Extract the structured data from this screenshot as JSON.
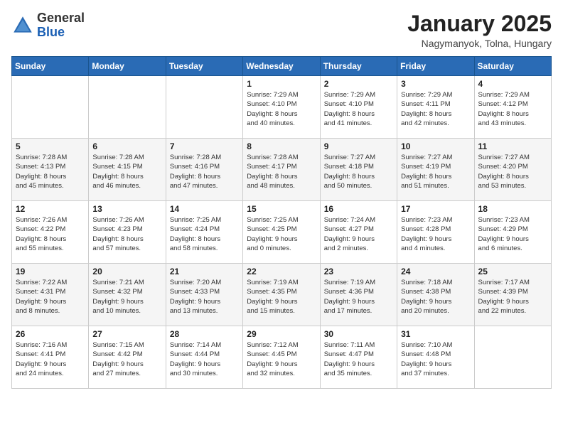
{
  "logo": {
    "general": "General",
    "blue": "Blue"
  },
  "header": {
    "month": "January 2025",
    "location": "Nagymanyok, Tolna, Hungary"
  },
  "weekdays": [
    "Sunday",
    "Monday",
    "Tuesday",
    "Wednesday",
    "Thursday",
    "Friday",
    "Saturday"
  ],
  "weeks": [
    [
      {
        "day": "",
        "info": ""
      },
      {
        "day": "",
        "info": ""
      },
      {
        "day": "",
        "info": ""
      },
      {
        "day": "1",
        "info": "Sunrise: 7:29 AM\nSunset: 4:10 PM\nDaylight: 8 hours\nand 40 minutes."
      },
      {
        "day": "2",
        "info": "Sunrise: 7:29 AM\nSunset: 4:10 PM\nDaylight: 8 hours\nand 41 minutes."
      },
      {
        "day": "3",
        "info": "Sunrise: 7:29 AM\nSunset: 4:11 PM\nDaylight: 8 hours\nand 42 minutes."
      },
      {
        "day": "4",
        "info": "Sunrise: 7:29 AM\nSunset: 4:12 PM\nDaylight: 8 hours\nand 43 minutes."
      }
    ],
    [
      {
        "day": "5",
        "info": "Sunrise: 7:28 AM\nSunset: 4:13 PM\nDaylight: 8 hours\nand 45 minutes."
      },
      {
        "day": "6",
        "info": "Sunrise: 7:28 AM\nSunset: 4:15 PM\nDaylight: 8 hours\nand 46 minutes."
      },
      {
        "day": "7",
        "info": "Sunrise: 7:28 AM\nSunset: 4:16 PM\nDaylight: 8 hours\nand 47 minutes."
      },
      {
        "day": "8",
        "info": "Sunrise: 7:28 AM\nSunset: 4:17 PM\nDaylight: 8 hours\nand 48 minutes."
      },
      {
        "day": "9",
        "info": "Sunrise: 7:27 AM\nSunset: 4:18 PM\nDaylight: 8 hours\nand 50 minutes."
      },
      {
        "day": "10",
        "info": "Sunrise: 7:27 AM\nSunset: 4:19 PM\nDaylight: 8 hours\nand 51 minutes."
      },
      {
        "day": "11",
        "info": "Sunrise: 7:27 AM\nSunset: 4:20 PM\nDaylight: 8 hours\nand 53 minutes."
      }
    ],
    [
      {
        "day": "12",
        "info": "Sunrise: 7:26 AM\nSunset: 4:22 PM\nDaylight: 8 hours\nand 55 minutes."
      },
      {
        "day": "13",
        "info": "Sunrise: 7:26 AM\nSunset: 4:23 PM\nDaylight: 8 hours\nand 57 minutes."
      },
      {
        "day": "14",
        "info": "Sunrise: 7:25 AM\nSunset: 4:24 PM\nDaylight: 8 hours\nand 58 minutes."
      },
      {
        "day": "15",
        "info": "Sunrise: 7:25 AM\nSunset: 4:25 PM\nDaylight: 9 hours\nand 0 minutes."
      },
      {
        "day": "16",
        "info": "Sunrise: 7:24 AM\nSunset: 4:27 PM\nDaylight: 9 hours\nand 2 minutes."
      },
      {
        "day": "17",
        "info": "Sunrise: 7:23 AM\nSunset: 4:28 PM\nDaylight: 9 hours\nand 4 minutes."
      },
      {
        "day": "18",
        "info": "Sunrise: 7:23 AM\nSunset: 4:29 PM\nDaylight: 9 hours\nand 6 minutes."
      }
    ],
    [
      {
        "day": "19",
        "info": "Sunrise: 7:22 AM\nSunset: 4:31 PM\nDaylight: 9 hours\nand 8 minutes."
      },
      {
        "day": "20",
        "info": "Sunrise: 7:21 AM\nSunset: 4:32 PM\nDaylight: 9 hours\nand 10 minutes."
      },
      {
        "day": "21",
        "info": "Sunrise: 7:20 AM\nSunset: 4:33 PM\nDaylight: 9 hours\nand 13 minutes."
      },
      {
        "day": "22",
        "info": "Sunrise: 7:19 AM\nSunset: 4:35 PM\nDaylight: 9 hours\nand 15 minutes."
      },
      {
        "day": "23",
        "info": "Sunrise: 7:19 AM\nSunset: 4:36 PM\nDaylight: 9 hours\nand 17 minutes."
      },
      {
        "day": "24",
        "info": "Sunrise: 7:18 AM\nSunset: 4:38 PM\nDaylight: 9 hours\nand 20 minutes."
      },
      {
        "day": "25",
        "info": "Sunrise: 7:17 AM\nSunset: 4:39 PM\nDaylight: 9 hours\nand 22 minutes."
      }
    ],
    [
      {
        "day": "26",
        "info": "Sunrise: 7:16 AM\nSunset: 4:41 PM\nDaylight: 9 hours\nand 24 minutes."
      },
      {
        "day": "27",
        "info": "Sunrise: 7:15 AM\nSunset: 4:42 PM\nDaylight: 9 hours\nand 27 minutes."
      },
      {
        "day": "28",
        "info": "Sunrise: 7:14 AM\nSunset: 4:44 PM\nDaylight: 9 hours\nand 30 minutes."
      },
      {
        "day": "29",
        "info": "Sunrise: 7:12 AM\nSunset: 4:45 PM\nDaylight: 9 hours\nand 32 minutes."
      },
      {
        "day": "30",
        "info": "Sunrise: 7:11 AM\nSunset: 4:47 PM\nDaylight: 9 hours\nand 35 minutes."
      },
      {
        "day": "31",
        "info": "Sunrise: 7:10 AM\nSunset: 4:48 PM\nDaylight: 9 hours\nand 37 minutes."
      },
      {
        "day": "",
        "info": ""
      }
    ]
  ]
}
